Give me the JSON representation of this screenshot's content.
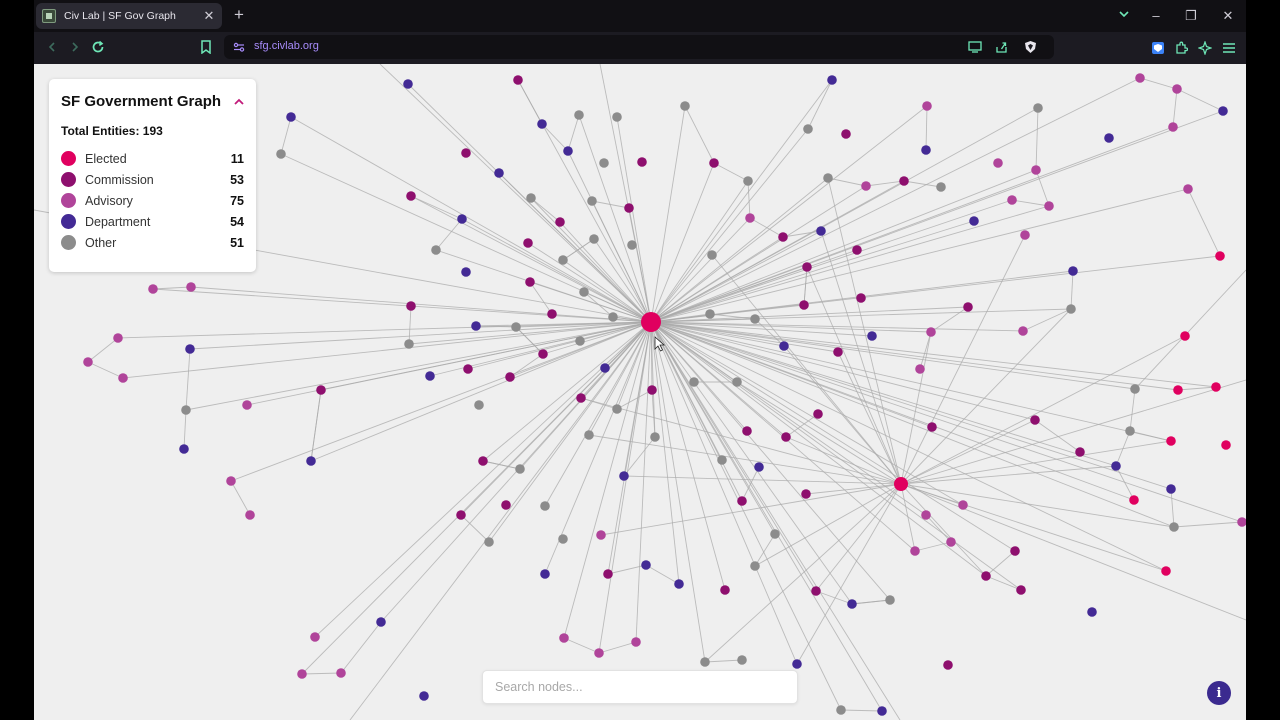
{
  "browser": {
    "tab_title": "Civ Lab | SF Gov Graph",
    "tab_close": "✕",
    "new_tab": "+",
    "url": "sfg.civlab.org",
    "window_controls": {
      "dropdown": "⌄",
      "minimize": "–",
      "restore": "❐",
      "close": "✕"
    }
  },
  "legend": {
    "title": "SF Government Graph",
    "total_label": "Total Entities: 193",
    "categories": [
      {
        "label": "Elected",
        "count": "11",
        "color": "#e0005f"
      },
      {
        "label": "Commission",
        "count": "53",
        "color": "#8e0f6e"
      },
      {
        "label": "Advisory",
        "count": "75",
        "color": "#b0449a"
      },
      {
        "label": "Department",
        "count": "54",
        "color": "#432a95"
      },
      {
        "label": "Other",
        "count": "51",
        "color": "#8c8c8c"
      }
    ]
  },
  "search": {
    "placeholder": "Search nodes..."
  },
  "info_button": {
    "label": "i"
  },
  "graph_style": {
    "edge_color": "#a9a9a9",
    "background": "#efefef"
  }
}
